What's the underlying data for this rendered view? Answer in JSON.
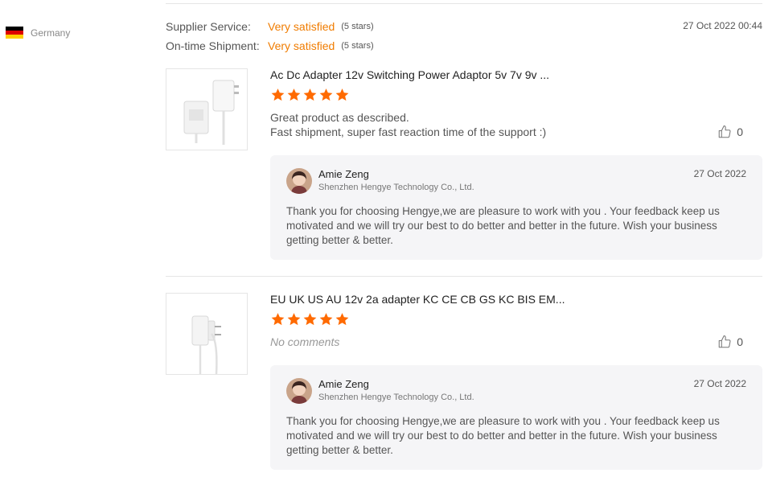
{
  "buyer": {
    "country": "Germany",
    "flag_colors": [
      "#000000",
      "#dd0000",
      "#ffce00"
    ]
  },
  "ratings": [
    {
      "label": "Supplier Service:",
      "value": "Very satisfied",
      "stars_text": "(5 stars)"
    },
    {
      "label": "On-time Shipment:",
      "value": "Very satisfied",
      "stars_text": "(5 stars)"
    }
  ],
  "review_date": "27 Oct 2022 00:44",
  "reviews": [
    {
      "product_title": "Ac Dc Adapter 12v Switching Power Adaptor 5v 7v 9v ...",
      "rating": 5,
      "comment_lines": [
        "Great product as described.",
        "Fast shipment, super fast reaction time of the support :)"
      ],
      "likes": "0",
      "thumbnail_icon": "wall-adapter-us-icon",
      "reply": {
        "name": "Amie Zeng",
        "company": "Shenzhen Hengye Technology Co., Ltd.",
        "date": "27 Oct 2022",
        "text": "Thank you for choosing Hengye,we are pleasure to work with you . Your feedback keep us motivated and we will try our best to do better and better in the future. Wish your business getting better & better."
      }
    },
    {
      "product_title": "EU UK US AU 12v 2a adapter KC CE CB GS KC BIS EM...",
      "rating": 5,
      "comment": "No comments",
      "likes": "0",
      "thumbnail_icon": "wall-adapter-eu-icon",
      "reply": {
        "name": "Amie Zeng",
        "company": "Shenzhen Hengye Technology Co., Ltd.",
        "date": "27 Oct 2022",
        "text": "Thank you for choosing Hengye,we are pleasure to work with you . Your feedback keep us motivated and we will try our best to do better and better in the future. Wish your business getting better & better."
      }
    }
  ],
  "colors": {
    "accent": "#f07c00",
    "star": "#ff6a00",
    "reply_bg": "#f5f5f7"
  }
}
